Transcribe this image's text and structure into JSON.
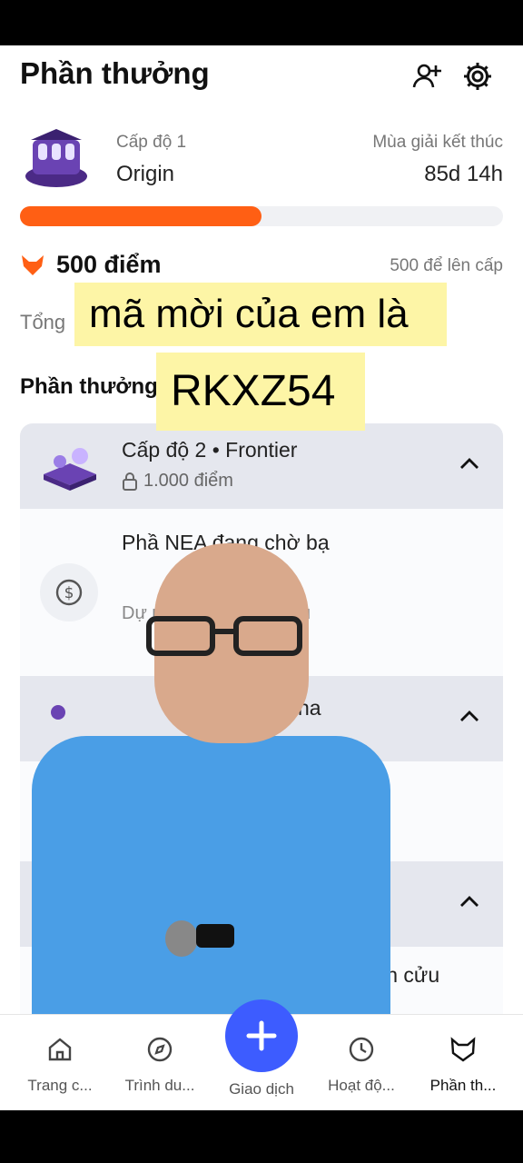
{
  "header": {
    "title": "Phần thưởng",
    "add_user_icon": "add-user-icon",
    "settings_icon": "gear-icon"
  },
  "season": {
    "level_label": "Cấp độ 1",
    "level_name": "Origin",
    "end_label": "Mùa giải kết thúc",
    "remaining": "85d 14h",
    "progress": 0.5
  },
  "points": {
    "value_text": "500 điểm",
    "next_level_text": "500 để lên cấp"
  },
  "total_label": "Tổng",
  "rewards_section_title": "Phần thưởng",
  "cards": [
    {
      "title": "Cấp độ 2 • Frontier",
      "lock_text": "1.000 điểm"
    },
    {
      "title": "na"
    },
    {
      "title": ""
    }
  ],
  "rewards": [
    {
      "title": "Phầ                      NEA đang chờ bạ",
      "desc": "Dự                       ủa bạn vào cuối mù",
      "icon": "dollar-icon"
    },
    {
      "title": "Giảm 50% phí Hợp đồng vĩnh cửu",
      "icon": "tag-icon"
    }
  ],
  "overlay": {
    "line1": "mã mời của em là",
    "line2": "RKXZ54"
  },
  "nav": {
    "items": [
      {
        "label": "Trang c...",
        "icon": "home-icon"
      },
      {
        "label": "Trình du...",
        "icon": "compass-icon"
      },
      {
        "label": "Giao dịch",
        "icon": "plus-icon"
      },
      {
        "label": "Hoạt độ...",
        "icon": "clock-icon"
      },
      {
        "label": "Phần th...",
        "icon": "reward-icon"
      }
    ]
  },
  "colors": {
    "accent": "#ff5f14",
    "fab": "#3d5cff",
    "caption_bg": "#fdf5a6"
  }
}
